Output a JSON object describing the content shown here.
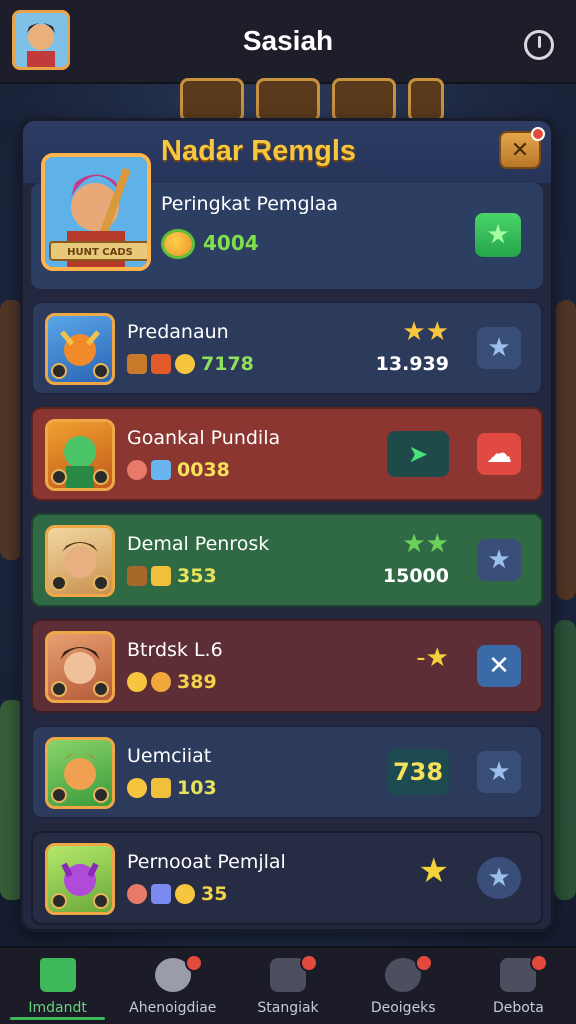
{
  "header": {
    "title": "Sasiah"
  },
  "panel": {
    "title": "Nadar Remgls",
    "close_label": "✕",
    "hero": {
      "name": "Peringkat Pemglaa",
      "banner": "HUNT CADS",
      "score": "4004",
      "action_icon": "star-icon"
    },
    "rows": [
      {
        "name": "Predanaun",
        "stat": "7178",
        "right_top": "★★",
        "right_num": "13.939",
        "color": "#2c3a5c",
        "stat_color": "#8fe05a",
        "btn_icon": "star-icon"
      },
      {
        "name": "Goankal Pundila",
        "stat": "0038",
        "right_badge": "➤",
        "color": "#8b3630",
        "stat_color": "#f6e25a",
        "btn_icon": "cloud-icon"
      },
      {
        "name": "Demal Penrosk",
        "stat": "353",
        "right_top": "★★",
        "right_num": "15000",
        "color": "#2f6a45",
        "stat_color": "#e7e45a",
        "btn_icon": "star-icon"
      },
      {
        "name": "Btrdsk L.6",
        "stat": "389",
        "right_top": "-★",
        "color": "#5e2e36",
        "stat_color": "#f2d24a",
        "btn_icon": "close-icon"
      },
      {
        "name": "Uemciiat",
        "stat": "103",
        "right_badge": "738",
        "color": "#2c3a5c",
        "stat_color": "#e7e45a",
        "btn_icon": "star-icon"
      },
      {
        "name": "Pernooat Pemjlal",
        "stat": "35",
        "right_top": "★",
        "color": "#262c44",
        "stat_color": "#f2d24a",
        "btn_icon": "star-icon"
      }
    ]
  },
  "nav": {
    "items": [
      {
        "label": "Imdandt",
        "icon": "home-icon",
        "active": true
      },
      {
        "label": "Ahenoigdiae",
        "icon": "ball-icon"
      },
      {
        "label": "Stangiak",
        "icon": "shop-icon"
      },
      {
        "label": "Deoigeks",
        "icon": "tools-icon"
      },
      {
        "label": "Debota",
        "icon": "truck-icon"
      }
    ]
  },
  "colors": {
    "accent": "#f6c63e",
    "active_nav": "#3fb85a"
  }
}
